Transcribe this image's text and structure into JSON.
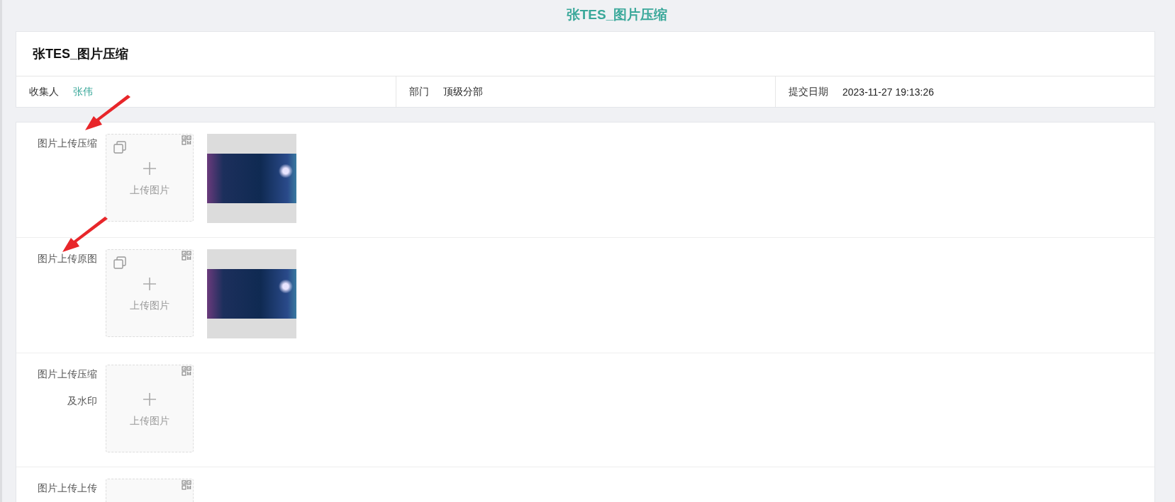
{
  "page_title": "张TES_图片压缩",
  "form": {
    "title": "张TES_图片压缩",
    "info": [
      {
        "label": "收集人",
        "value": "张伟",
        "kind": "link"
      },
      {
        "label": "部门",
        "value": "顶级分部",
        "kind": "plain"
      },
      {
        "label": "提交日期",
        "value": "2023-11-27 19:13:26",
        "kind": "plain"
      }
    ]
  },
  "fields": [
    {
      "label": "图片上传压缩",
      "upload_label": "上传图片",
      "thumbnail": true
    },
    {
      "label": "图片上传原图",
      "upload_label": "上传图片",
      "thumbnail": true
    },
    {
      "label": "图片上传压缩及水印",
      "upload_label": "上传图片",
      "thumbnail": false
    },
    {
      "label": "图片上传上传",
      "thumbnail": false
    }
  ]
}
